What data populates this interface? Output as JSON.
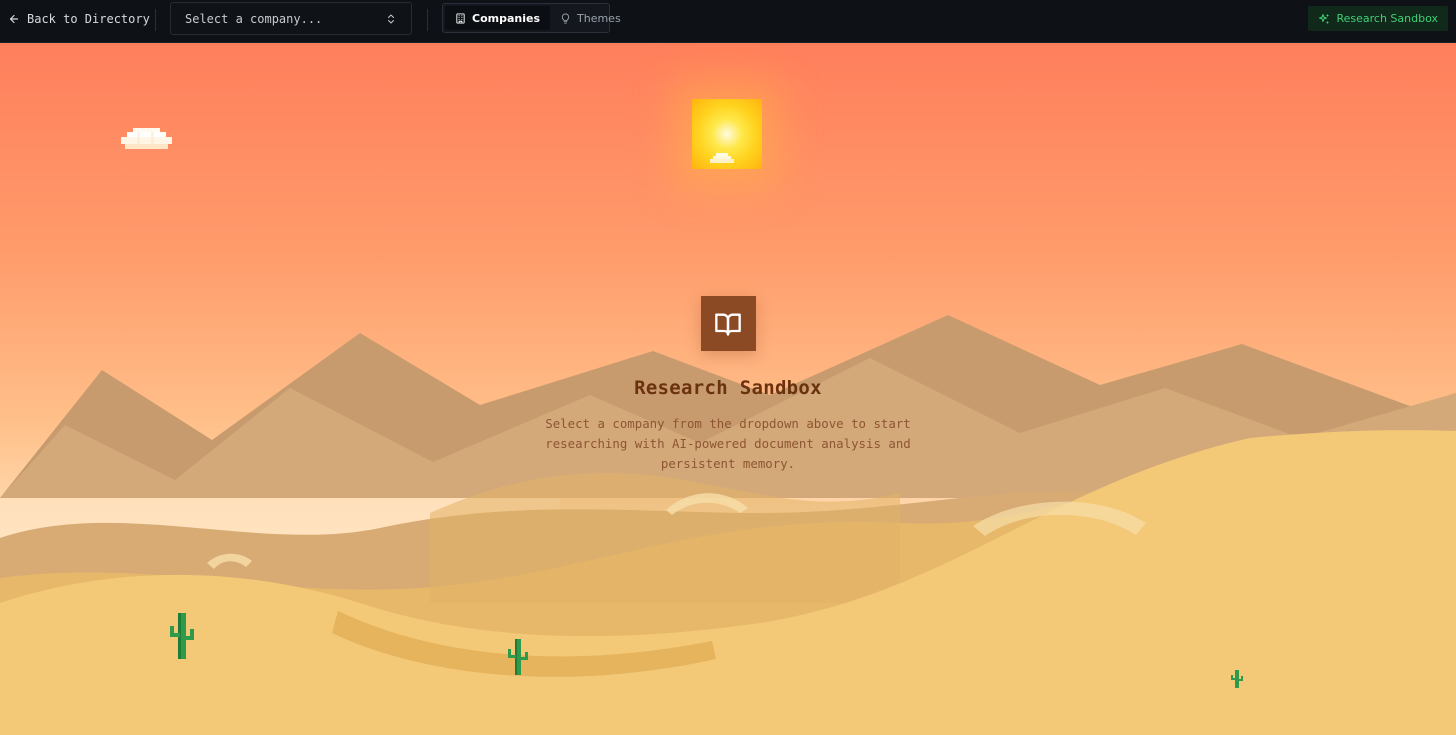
{
  "topbar": {
    "back_label": "Back to Directory",
    "company_select": {
      "placeholder": "Select a company..."
    },
    "tabs": [
      {
        "label": "Companies",
        "icon": "building-icon",
        "active": true
      },
      {
        "label": "Themes",
        "icon": "lightbulb-icon",
        "active": false
      }
    ],
    "research_button": {
      "label": "Research Sandbox",
      "icon": "sparkles-icon"
    }
  },
  "main": {
    "icon": "book-open-icon",
    "title": "Research Sandbox",
    "description": "Select a company from the dropdown above to start researching with AI-powered document analysis and persistent memory."
  },
  "colors": {
    "topbar_bg": "#0e1116",
    "accent_green": "#3ecf76",
    "sky_top": "#ff7f5c",
    "sand": "#f3c877",
    "title_brown": "#6b3210",
    "icon_box": "#8c4a24"
  }
}
